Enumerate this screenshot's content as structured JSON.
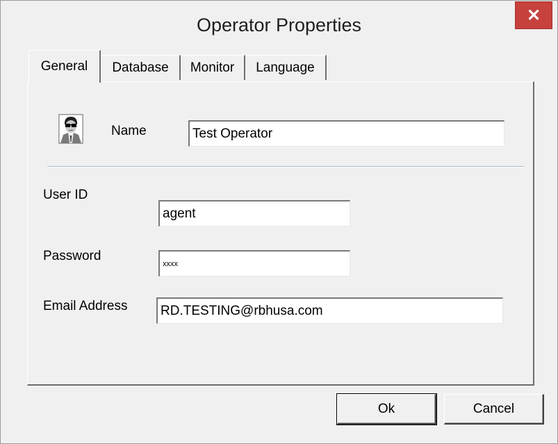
{
  "window": {
    "title": "Operator Properties",
    "close_symbol": "✕"
  },
  "tabs": [
    {
      "label": "General",
      "active": true
    },
    {
      "label": "Database",
      "active": false
    },
    {
      "label": "Monitor",
      "active": false
    },
    {
      "label": "Language",
      "active": false
    }
  ],
  "general": {
    "avatar_icon": "operator-avatar-icon",
    "name_label": "Name",
    "name_value": "Test Operator",
    "user_id_label": "User ID",
    "user_id_value": "agent",
    "password_label": "Password",
    "password_value": "xxxx",
    "email_label": "Email Address",
    "email_value": "RD.TESTING@rbhusa.com"
  },
  "buttons": {
    "ok_label": "Ok",
    "cancel_label": "Cancel"
  },
  "colors": {
    "close_button": "#c7413d",
    "dialog_background": "#f0f0f0",
    "separator": "#a7b9cc"
  }
}
